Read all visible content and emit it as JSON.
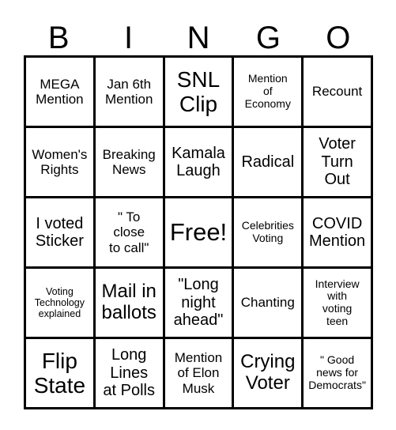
{
  "card": {
    "title": "BINGO",
    "header_letters": [
      "B",
      "I",
      "N",
      "G",
      "O"
    ],
    "grid_size": "5x5",
    "colors": {
      "background": "#ffffff",
      "text": "#000000",
      "border": "#000000"
    },
    "rows": [
      [
        {
          "text": "MEGA\nMention",
          "size": "m"
        },
        {
          "text": "Jan 6th\nMention",
          "size": "m"
        },
        {
          "text": "SNL\nClip",
          "size": "xxl"
        },
        {
          "text": "Mention\nof\nEconomy",
          "size": "s"
        },
        {
          "text": "Recount",
          "size": "m"
        }
      ],
      [
        {
          "text": "Women's\nRights",
          "size": "m"
        },
        {
          "text": "Breaking\nNews",
          "size": "m"
        },
        {
          "text": "Kamala\nLaugh",
          "size": "l"
        },
        {
          "text": "Radical",
          "size": "l"
        },
        {
          "text": "Voter\nTurn\nOut",
          "size": "l"
        }
      ],
      [
        {
          "text": "I voted\nSticker",
          "size": "l"
        },
        {
          "text": "\" To\nclose\nto call\"",
          "size": "m"
        },
        {
          "text": "Free!",
          "size": "huge"
        },
        {
          "text": "Celebrities\nVoting",
          "size": "s"
        },
        {
          "text": "COVID\nMention",
          "size": "l"
        }
      ],
      [
        {
          "text": "Voting\nTechnology\nexplained",
          "size": "xs"
        },
        {
          "text": "Mail in\nballots",
          "size": "xl"
        },
        {
          "text": "\"Long\nnight\nahead\"",
          "size": "l"
        },
        {
          "text": "Chanting",
          "size": "m"
        },
        {
          "text": "Interview\nwith\nvoting\nteen",
          "size": "s"
        }
      ],
      [
        {
          "text": "Flip\nState",
          "size": "xxl"
        },
        {
          "text": "Long\nLines\nat Polls",
          "size": "l"
        },
        {
          "text": "Mention\nof Elon\nMusk",
          "size": "m"
        },
        {
          "text": "Crying\nVoter",
          "size": "xl"
        },
        {
          "text": "\" Good\nnews for\nDemocrats\"",
          "size": "s"
        }
      ]
    ]
  }
}
